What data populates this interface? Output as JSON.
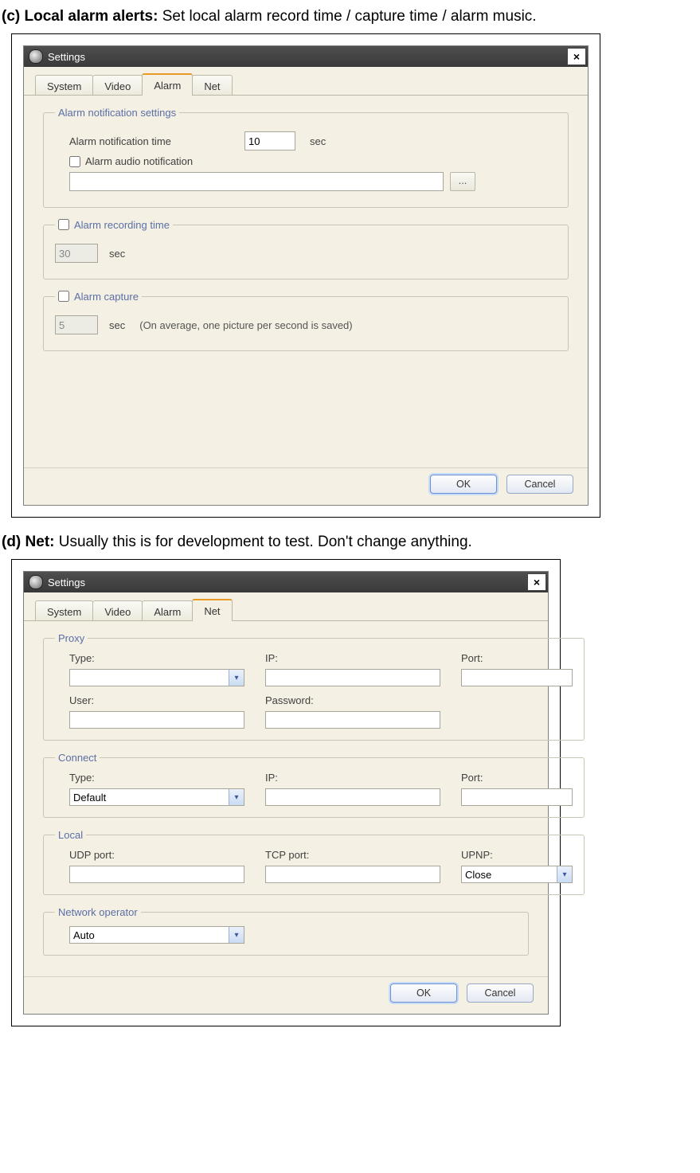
{
  "docC": {
    "bold": "(c) Local alarm alerts:",
    "rest": " Set local alarm record time / capture time / alarm music."
  },
  "docD": {
    "bold": "(d) Net:",
    "rest": " Usually this is for development to test. Don't change anything."
  },
  "winTitle": "Settings",
  "tabs": {
    "system": "System",
    "video": "Video",
    "alarm": "Alarm",
    "net": "Net"
  },
  "buttons": {
    "ok": "OK",
    "cancel": "Cancel",
    "browse": "..."
  },
  "alarm": {
    "grp_notify": "Alarm notification settings",
    "notify_time_label": "Alarm notification time",
    "notify_time_value": "10",
    "sec": "sec",
    "audio_label": "Alarm audio notification",
    "audio_path": "",
    "grp_record": "Alarm recording time",
    "record_value": "30",
    "grp_capture": "Alarm capture",
    "capture_value": "5",
    "capture_note": "(On average, one picture per second is saved)"
  },
  "net": {
    "grp_proxy": "Proxy",
    "type": "Type:",
    "ip": "IP:",
    "port": "Port:",
    "user": "User:",
    "password": "Password:",
    "proxy_type": "",
    "grp_connect": "Connect",
    "connect_type": "Default",
    "grp_local": "Local",
    "udp": "UDP port:",
    "tcp": "TCP port:",
    "upnp": "UPNP:",
    "upnp_value": "Close",
    "grp_operator": "Network operator",
    "operator_value": "Auto"
  }
}
